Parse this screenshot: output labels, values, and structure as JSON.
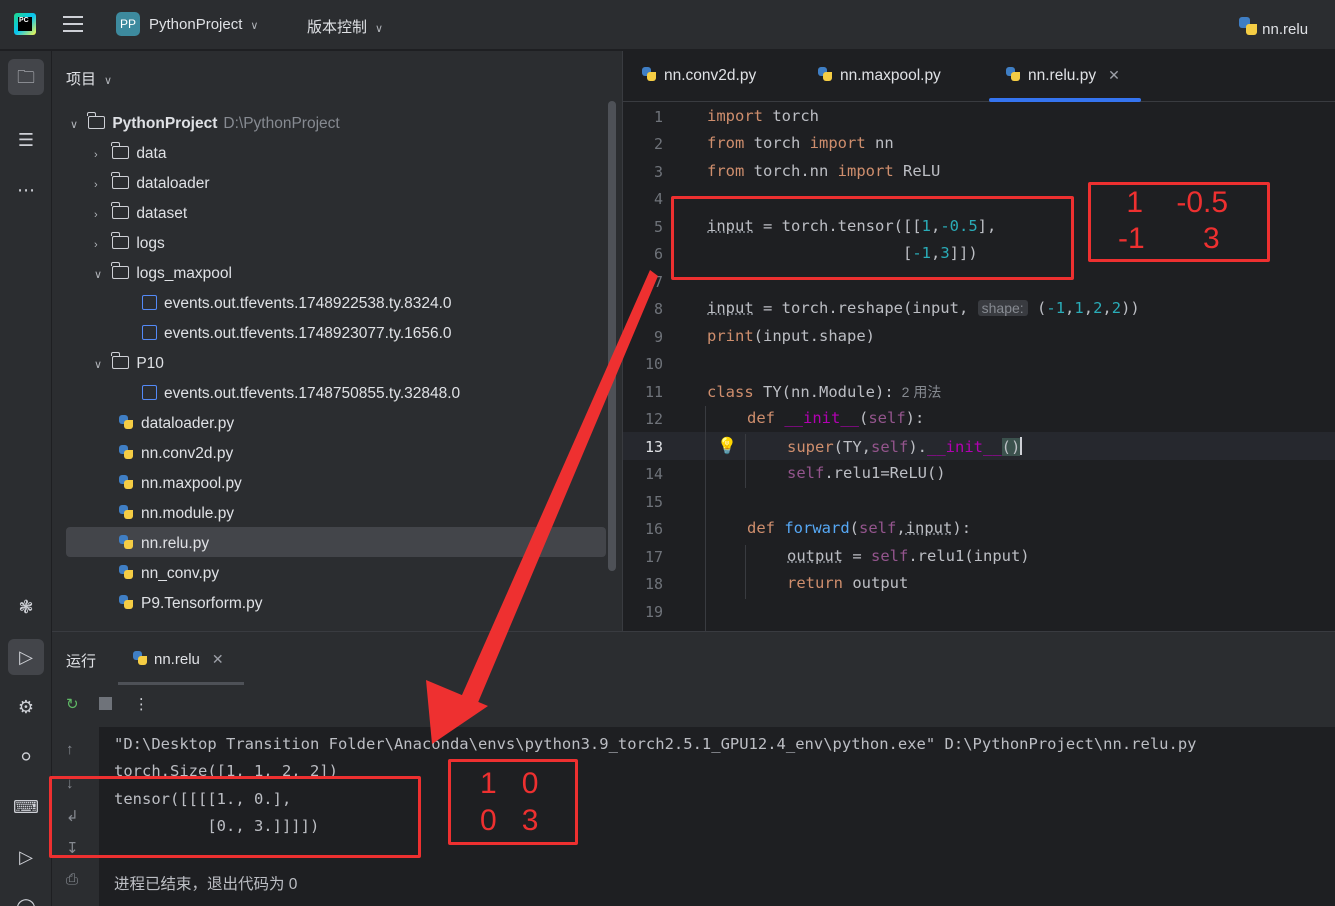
{
  "titlebar": {
    "project_badge": "PP",
    "project_name": "PythonProject",
    "vcs": "版本控制",
    "run_config": "nn.relu"
  },
  "project_panel": {
    "header": "项目",
    "root_name": "PythonProject",
    "root_path": "D:\\PythonProject",
    "items": [
      {
        "label": "data",
        "kind": "folder"
      },
      {
        "label": "dataloader",
        "kind": "folder"
      },
      {
        "label": "dataset",
        "kind": "folder"
      },
      {
        "label": "logs",
        "kind": "folder"
      },
      {
        "label": "logs_maxpool",
        "kind": "folder-open"
      },
      {
        "label": "events.out.tfevents.1748922538.ty.8324.0",
        "kind": "file"
      },
      {
        "label": "events.out.tfevents.1748923077.ty.1656.0",
        "kind": "file"
      },
      {
        "label": "P10",
        "kind": "folder-open"
      },
      {
        "label": "events.out.tfevents.1748750855.ty.32848.0",
        "kind": "file"
      },
      {
        "label": "dataloader.py",
        "kind": "py"
      },
      {
        "label": "nn.conv2d.py",
        "kind": "py"
      },
      {
        "label": "nn.maxpool.py",
        "kind": "py"
      },
      {
        "label": "nn.module.py",
        "kind": "py"
      },
      {
        "label": "nn.relu.py",
        "kind": "py"
      },
      {
        "label": "nn_conv.py",
        "kind": "py"
      },
      {
        "label": "P9.Tensorform.py",
        "kind": "py"
      }
    ]
  },
  "editor": {
    "tabs": [
      "nn.conv2d.py",
      "nn.maxpool.py",
      "nn.relu.py"
    ],
    "active_tab": "nn.relu.py",
    "line_numbers": [
      "1",
      "2",
      "3",
      "4",
      "5",
      "6",
      "7",
      "8",
      "9",
      "10",
      "11",
      "12",
      "13",
      "14",
      "15",
      "16",
      "17",
      "18",
      "19"
    ],
    "current_line": "13",
    "code": {
      "l1_import": "import",
      "l1_mod": " torch",
      "l2_from": "from",
      "l2_mod": " torch ",
      "l2_import": "import",
      "l2_name": " nn",
      "l3_from": "from",
      "l3_mod": " torch.nn ",
      "l3_import": "import",
      "l3_name": " ReLU",
      "l5_var": "input",
      "l5_rest": " = torch.tensor([[",
      "l5_n1": "1",
      "l5_c": ",",
      "l5_n2": "-0.5",
      "l5_end": "],",
      "l6_pre": "                     [",
      "l6_n1": "-1",
      "l6_c": ",",
      "l6_n2": "3",
      "l6_end": "]])",
      "l8_var": "input",
      "l8_rest": " = torch.reshape(input, ",
      "l8_hint": "shape:",
      "l8_args_open": " (",
      "l8_a1": "-1",
      "l8_s1": ",",
      "l8_a2": "1",
      "l8_s2": ",",
      "l8_a3": "2",
      "l8_s3": ",",
      "l8_a4": "2",
      "l8_close": "))",
      "l9_print": "print",
      "l9_rest": "(input.shape)",
      "l11_class": "class",
      "l11_rest": " TY(nn.Module):",
      "l11_usages": "2 用法",
      "l12_def": "def",
      "l12_sp": " ",
      "l12_init": "__init__",
      "l12_open": "(",
      "l12_self": "self",
      "l12_close": "):",
      "l13_super": "super",
      "l13_open": "(TY,",
      "l13_self": "self",
      "l13_dot": ").",
      "l13_init": "__init__",
      "l13_parens": "()",
      "l14_self": "self",
      "l14_rest": ".relu1=ReLU()",
      "l16_def": "def",
      "l16_sp": " ",
      "l16_fn": "forward",
      "l16_open": "(",
      "l16_self": "self",
      "l16_comma": ",",
      "l16_arg": "input",
      "l16_close": "):",
      "l17_var": "output",
      "l17_eq": " = ",
      "l17_self": "self",
      "l17_rest": ".relu1(input)",
      "l18_return": "return",
      "l18_rest": " output"
    }
  },
  "run_panel": {
    "title": "运行",
    "tab": "nn.relu",
    "output": [
      "\"D:\\Desktop Transition Folder\\Anaconda\\envs\\python3.9_torch2.5.1_GPU12.4_env\\python.exe\" D:\\PythonProject\\nn.relu.py",
      "torch.Size([1, 1, 2, 2])",
      "tensor([[[[1., 0.],",
      "          [0., 3.]]]])",
      "进程已结束，退出代码为 0"
    ]
  },
  "annotations": {
    "input_matrix": {
      "row1": " 1    -0.5",
      "row2": "-1       3"
    },
    "output_matrix": {
      "row1": "1   0",
      "row2": "0   3"
    }
  },
  "colors": {
    "annotation_red": "#ee3030",
    "accent_blue": "#3574f0",
    "keyword": "#cf8e6d",
    "number": "#2aacb8"
  }
}
